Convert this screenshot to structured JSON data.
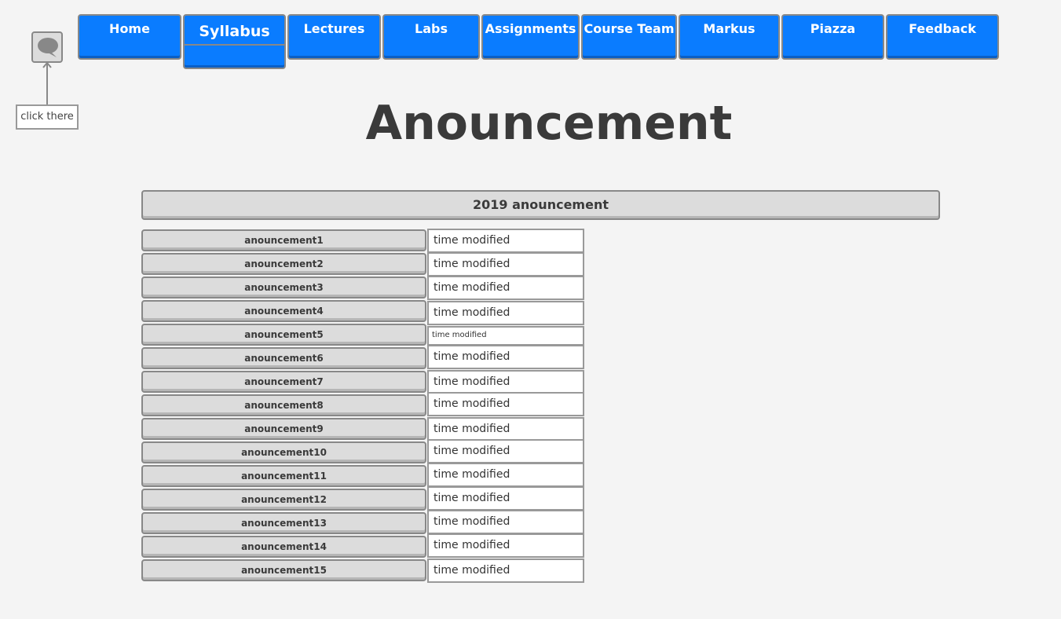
{
  "nav": {
    "items": [
      {
        "label": "Home"
      },
      {
        "label": "Syllabus"
      },
      {
        "label": "Lectures"
      },
      {
        "label": "Labs"
      },
      {
        "label": "Assignments"
      },
      {
        "label": "Course Team"
      },
      {
        "label": "Markus"
      },
      {
        "label": "Piazza"
      },
      {
        "label": "Feedback"
      }
    ],
    "active": "Syllabus"
  },
  "chat": {
    "icon": "speech-bubble-icon",
    "hint": "click there"
  },
  "page": {
    "title": "Anouncement"
  },
  "section": {
    "year_title": "2019 anouncement"
  },
  "announcements": [
    {
      "title": "anouncement1",
      "time": "time modified"
    },
    {
      "title": "anouncement2",
      "time": "time modified"
    },
    {
      "title": "anouncement3",
      "time": "time modified"
    },
    {
      "title": "anouncement4",
      "time": "time modified"
    },
    {
      "title": "anouncement5",
      "time": "time modified"
    },
    {
      "title": "anouncement6",
      "time": "time modified"
    },
    {
      "title": "anouncement7",
      "time": "time modified"
    },
    {
      "title": "anouncement8",
      "time": "time modified"
    },
    {
      "title": "anouncement9",
      "time": "time modified"
    },
    {
      "title": "anouncement10",
      "time": "time modified"
    },
    {
      "title": "anouncement11",
      "time": "time modified"
    },
    {
      "title": "anouncement12",
      "time": "time modified"
    },
    {
      "title": "anouncement13",
      "time": "time modified"
    },
    {
      "title": "anouncement14",
      "time": "time modified"
    },
    {
      "title": "anouncement15",
      "time": "time modified"
    }
  ],
  "colors": {
    "accent": "#0a7cff",
    "background": "#f4f4f4",
    "button_gray": "#dcdcdc"
  }
}
